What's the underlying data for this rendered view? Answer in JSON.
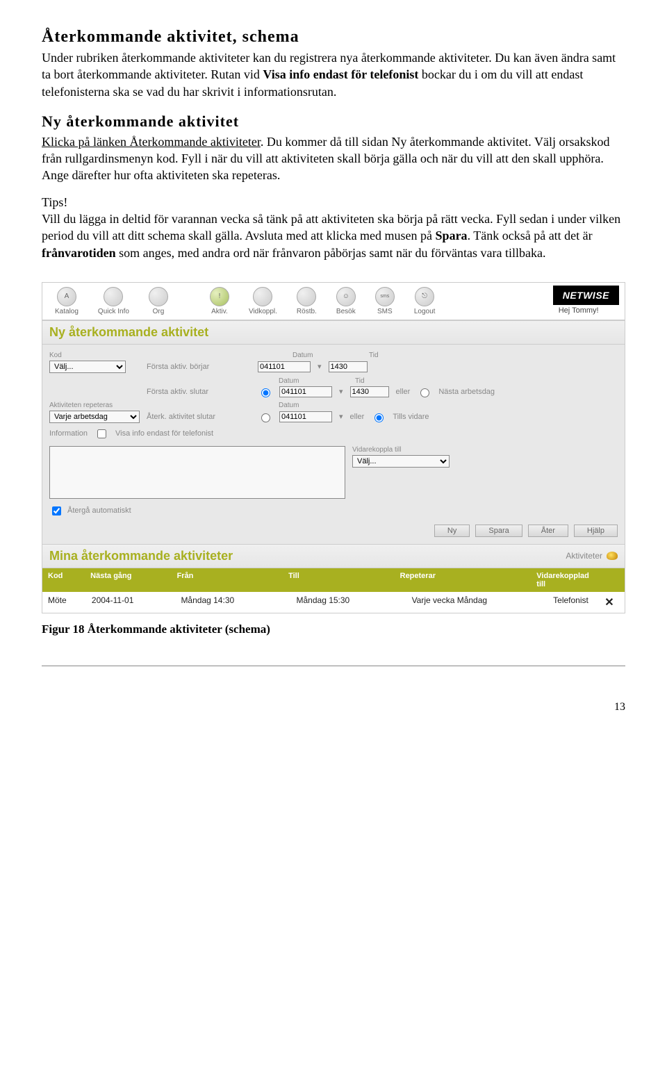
{
  "h1": "Återkommande aktivitet, schema",
  "p1": "Under rubriken återkommande aktiviteter kan du registrera nya återkommande aktiviteter. Du kan även ändra samt ta bort återkommande aktiviteter. Rutan vid Visa info endast för telefonist bockar du i om du vill att endast telefonisterna ska se vad du har skrivit i informationsrutan.",
  "h2": "Ny återkommande aktivitet",
  "p2": "Klicka på länken Återkommande aktiviteter. Du kommer då till sidan Ny återkommande aktivitet. Välj orsakskod från rullgardinsmenyn kod. Fyll i när du vill att aktiviteten skall börja gälla och när du vill att den skall upphöra. Ange därefter hur ofta aktiviteten ska repeteras.",
  "tipsLabel": "Tips!",
  "tipsText": "Vill du lägga in deltid för varannan vecka så tänk på att aktiviteten ska börja på rätt vecka. Fyll sedan i under vilken period du vill att ditt schema skall gälla. Avsluta med att klicka med musen på Spara. Tänk också på att det är frånvarotiden som anges, med andra ord när frånvaron påbörjas samt när du förväntas vara tillbaka.",
  "toolbar": {
    "items": [
      "Katalog",
      "Quick Info",
      "Org",
      "Aktiv.",
      "Vidkoppl.",
      "Röstb.",
      "Besök",
      "SMS",
      "Logout"
    ],
    "greeting": "Hej Tommy!",
    "logo": "NETWISE"
  },
  "form": {
    "title": "Ny återkommande aktivitet",
    "labels": {
      "kod": "Kod",
      "datum": "Datum",
      "tid": "Tid",
      "forstaBorjar": "Första aktiv. börjar",
      "forstaSlutar": "Första aktiv. slutar",
      "eller": "eller",
      "nastaArb": "Nästa arbetsdag",
      "repeteras": "Aktiviteten repeteras",
      "aterkSlutar": "Återk. aktivitet slutar",
      "tillsVidare": "Tills vidare",
      "information": "Information",
      "visaInfo": "Visa info endast för telefonist",
      "vidarekoppla": "Vidarekoppla till",
      "aterga": "Återgå automatiskt"
    },
    "values": {
      "kod": "Välj...",
      "date1": "041101",
      "time1": "1430",
      "date2": "041101",
      "time2": "1430",
      "rep": "Varje arbetsdag",
      "date3": "041101",
      "vkSelect": "Välj..."
    },
    "buttons": {
      "ny": "Ny",
      "spara": "Spara",
      "ater": "Åter",
      "hjalp": "Hjälp"
    }
  },
  "listSection": {
    "title": "Mina återkommande aktiviteter",
    "rightLabel": "Aktiviteter",
    "headers": {
      "kod": "Kod",
      "nasta": "Nästa gång",
      "fran": "Från",
      "till": "Till",
      "rep": "Repeterar",
      "vk": "Vidarekopplad till"
    },
    "row": {
      "kod": "Möte",
      "nasta": "2004-11-01",
      "fran": "Måndag 14:30",
      "till": "Måndag 15:30",
      "rep": "Varje vecka Måndag",
      "vk": "Telefonist",
      "x": "✕"
    }
  },
  "caption": "Figur 18  Återkommande aktiviteter (schema)",
  "pageNum": "13"
}
